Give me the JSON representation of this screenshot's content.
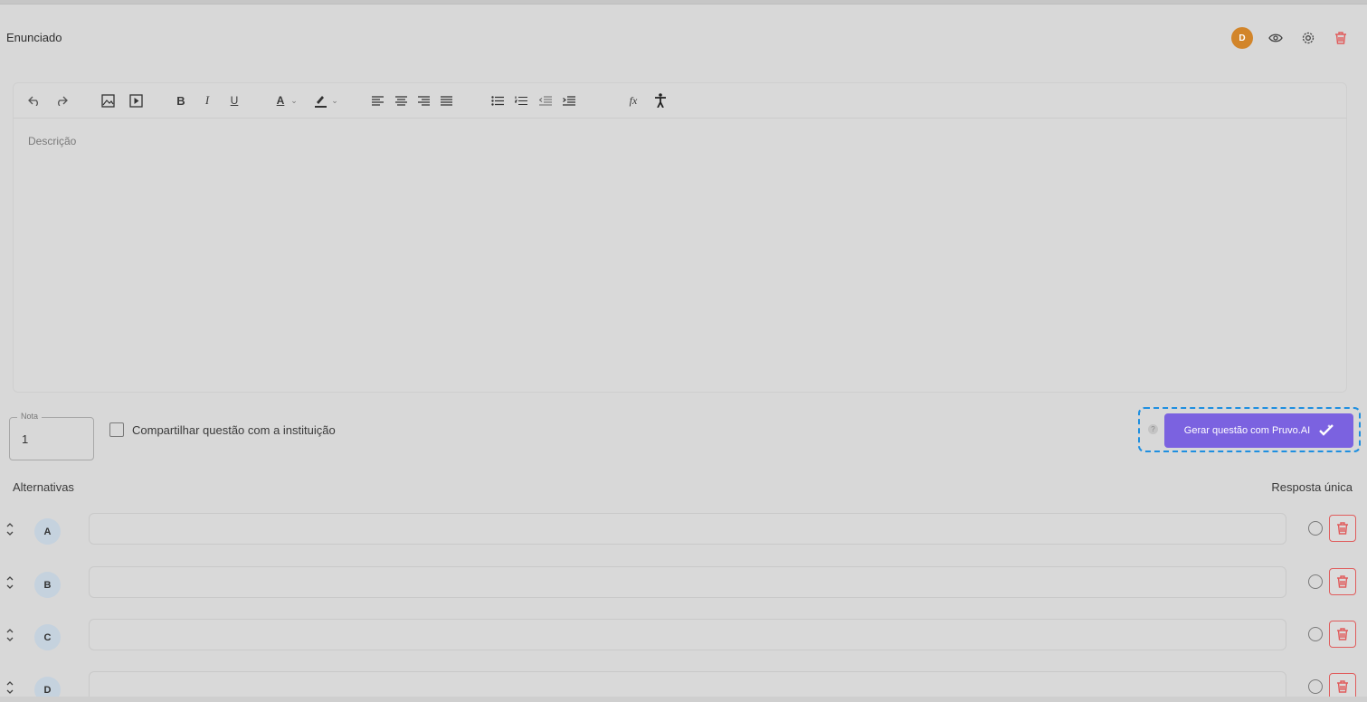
{
  "header": {
    "title": "Enunciado",
    "avatar_initial": "D"
  },
  "editor": {
    "placeholder": "Descrição"
  },
  "toolbar": {
    "bold": "B",
    "italic": "I",
    "underline": "U",
    "font_color": "A",
    "formula": "fx",
    "icons": [
      "undo-icon",
      "redo-icon",
      "image-icon",
      "video-icon",
      "bold-icon",
      "italic-icon",
      "underline-icon",
      "font-color-icon",
      "chevron-down-icon",
      "highlight-icon",
      "chevron-down-icon",
      "align-left-icon",
      "align-center-icon",
      "align-right-icon",
      "align-justify-icon",
      "bullet-list-icon",
      "numbered-list-icon",
      "outdent-icon",
      "indent-icon",
      "formula-icon",
      "accessibility-icon"
    ]
  },
  "nota": {
    "label": "Nota",
    "value": "1"
  },
  "share": {
    "label": "Compartilhar questão com a instituição"
  },
  "ai": {
    "help": "?",
    "button_label": "Gerar questão com Pruvo.AI"
  },
  "alternatives": {
    "label": "Alternativas",
    "response_type": "Resposta única",
    "items": [
      {
        "letter": "A",
        "value": ""
      },
      {
        "letter": "B",
        "value": ""
      },
      {
        "letter": "C",
        "value": ""
      },
      {
        "letter": "D",
        "value": ""
      }
    ]
  },
  "colors": {
    "accent": "#7b62e0",
    "danger": "#e05c5c",
    "focus": "#1e8fe0",
    "avatar": "#d2852a"
  }
}
